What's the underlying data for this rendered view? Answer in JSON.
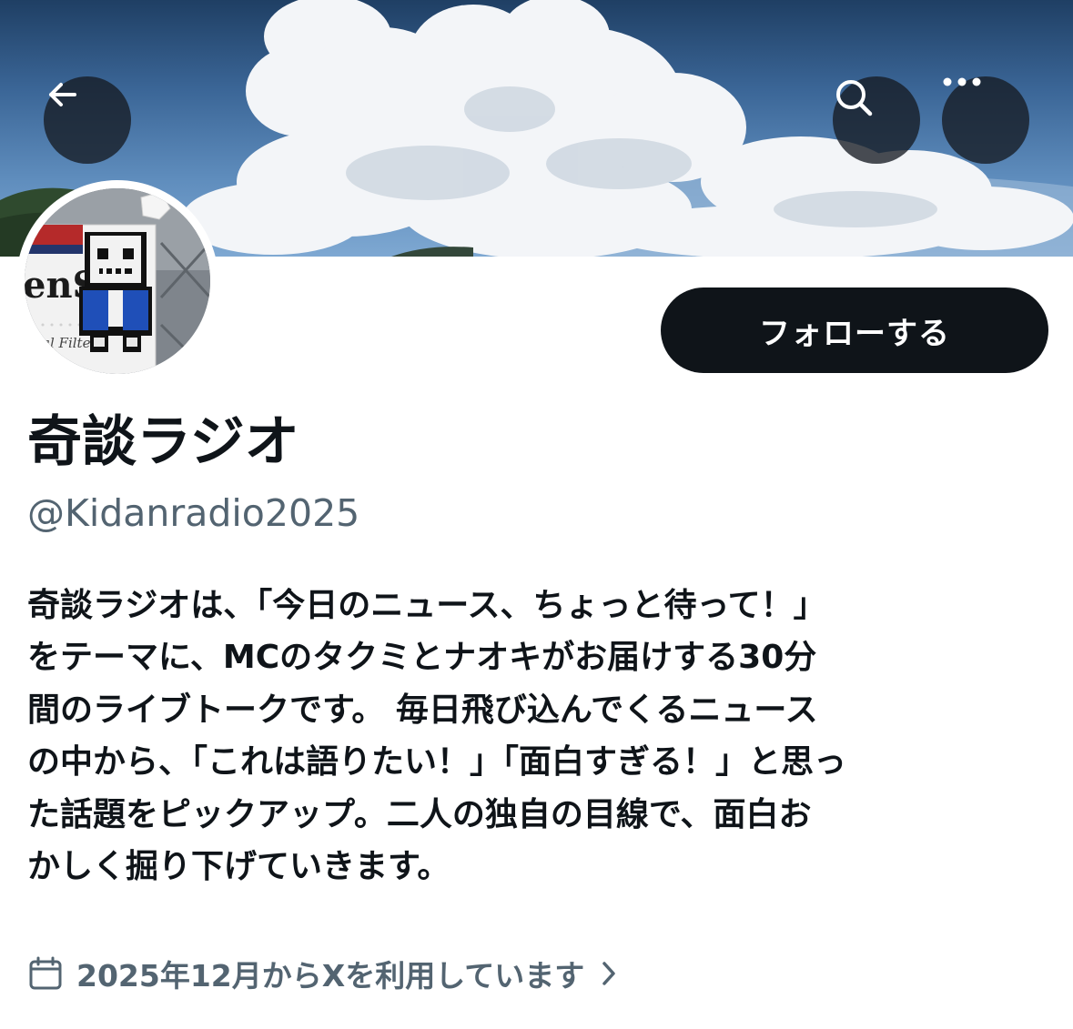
{
  "header": {
    "back_icon": "arrow-left-icon",
    "search_icon": "search-icon",
    "more_icon": "more-horizontal-icon"
  },
  "profile": {
    "display_name": "奇談ラジオ",
    "handle": "@Kidanradio2025",
    "follow_label": "フォローする",
    "bio": "奇談ラジオは、「今日のニュース、ちょっと待って！」\nをテーマに、MCのタクミとナオキがお届けする30分\n間のライブトークです。 毎日飛び込んでくるニュース\nの中から、「これは語りたい！」「面白すぎる！」と思っ\nた話題をピックアップ。二人の独自の目線で、面白お\nかしく掘り下げていきます。",
    "joined": "2025年12月からXを利用しています",
    "avatar_text": "enS",
    "avatar_subtext": "oal Filter"
  },
  "colors": {
    "text": "#0f1419",
    "secondary": "#536471",
    "button": "#0f1419"
  }
}
